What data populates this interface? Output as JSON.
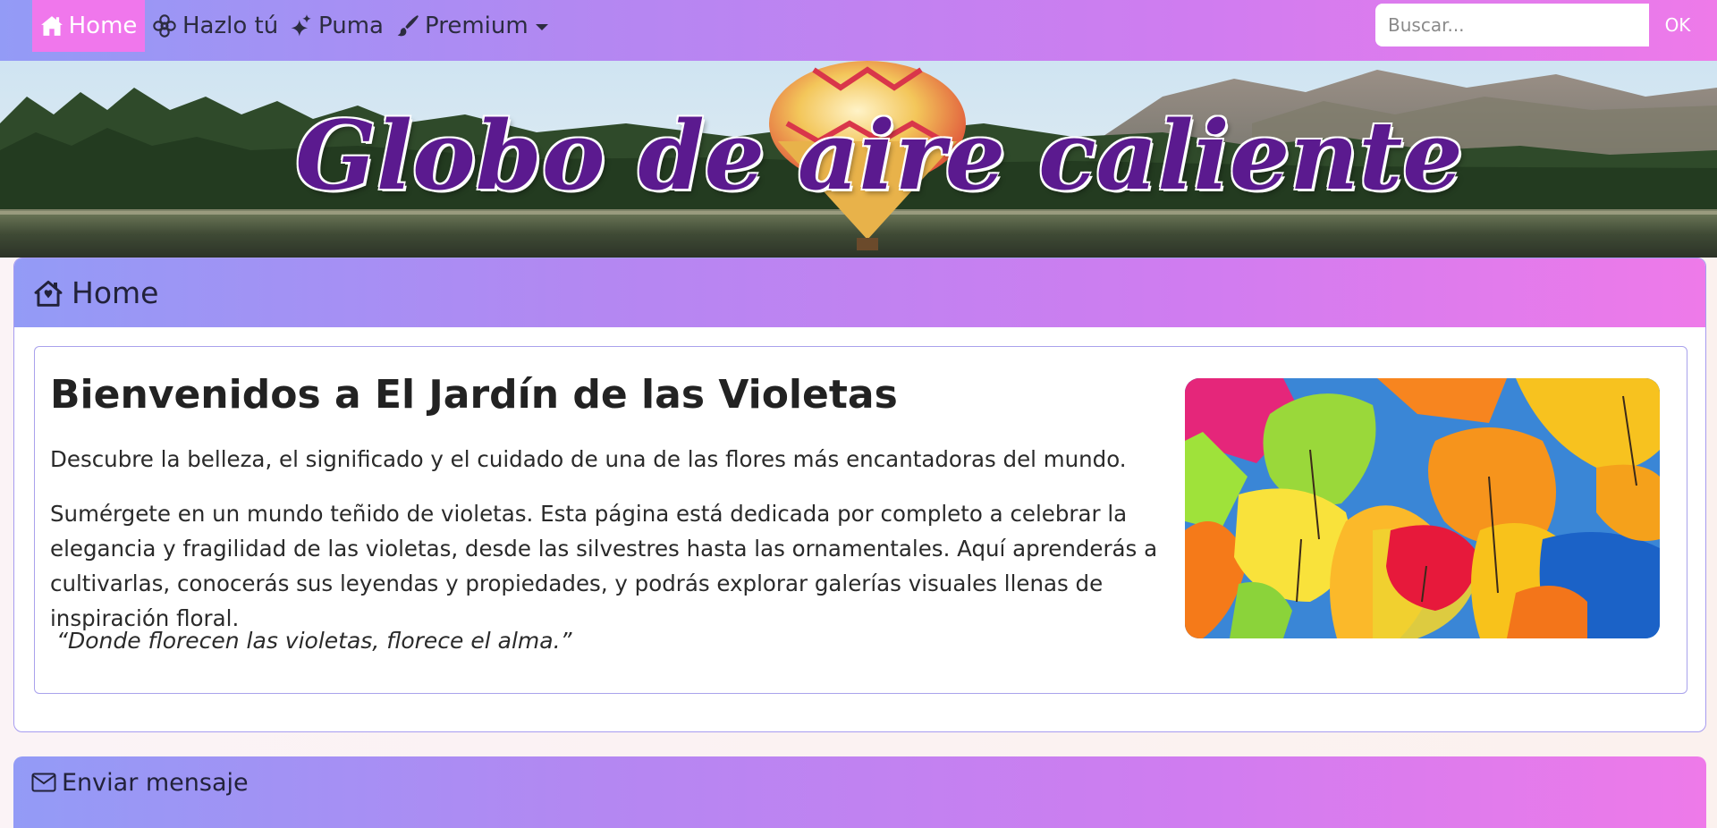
{
  "nav": {
    "items": [
      {
        "label": "Home",
        "icon": "house-icon"
      },
      {
        "label": "Hazlo tú",
        "icon": "flower-icon"
      },
      {
        "label": "Puma",
        "icon": "sparkles-icon"
      },
      {
        "label": "Premium",
        "icon": "brush-icon"
      }
    ],
    "search": {
      "placeholder": "Buscar...",
      "button": "OK"
    },
    "active_color": "#f077ec"
  },
  "banner": {
    "title": "Globo de aire caliente",
    "title_color": "#5b1a8f"
  },
  "home_card": {
    "header": "Home",
    "welcome_title": "Bienvenidos a El Jardín de las Violetas",
    "paragraph1": "Descubre la belleza, el significado y el cuidado de una de las flores más encantadoras del mundo.",
    "paragraph2": "Sumérgete en un mundo teñido de violetas. Esta página está dedicada por completo a celebrar la elegancia y fragilidad de las violetas, desde las silvestres hasta las ornamentales. Aquí aprenderás a cultivarlas, conocerás sus leyendas y propiedades, y podrás explorar galerías visuales llenas de inspiración floral.",
    "quote": "“Donde florecen las violetas, florece el alma.”"
  },
  "message_card": {
    "header": "Enviar mensaje"
  },
  "colors": {
    "gradient_start": "#939bf6",
    "gradient_end": "#ee7ae9",
    "border": "#a79cf0"
  }
}
